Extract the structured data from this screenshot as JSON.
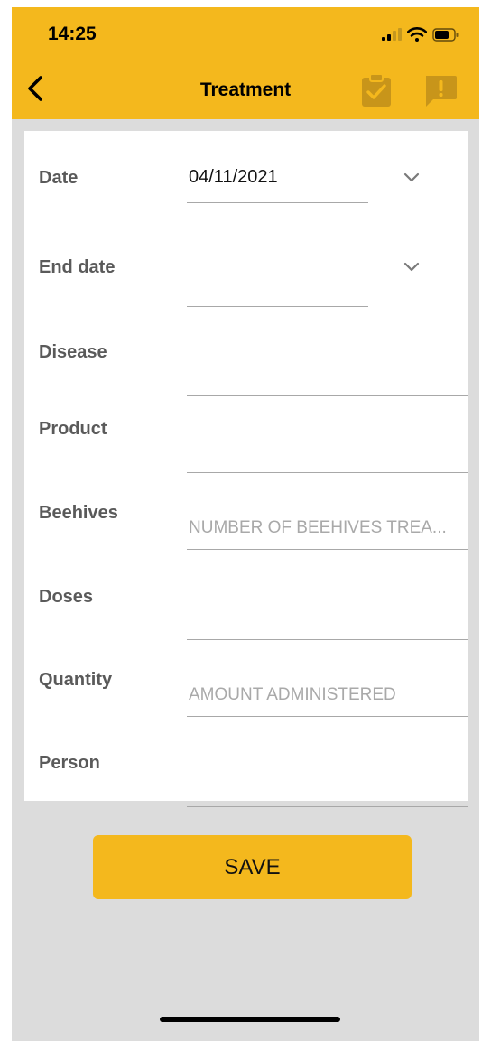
{
  "status_bar": {
    "time": "14:25",
    "icons": [
      "signal-icon",
      "wifi-icon",
      "battery-icon"
    ]
  },
  "nav": {
    "title": "Treatment",
    "back_icon": "chevron-left-icon",
    "actions": [
      "clipboard-check-icon",
      "alert-message-icon"
    ]
  },
  "form": {
    "fields": [
      {
        "label": "Date",
        "value": "04/11/2021",
        "type": "dropdown"
      },
      {
        "label": "End date",
        "value": "",
        "type": "dropdown"
      },
      {
        "label": "Disease",
        "value": "",
        "placeholder": ""
      },
      {
        "label": "Product",
        "value": "",
        "placeholder": ""
      },
      {
        "label": "Beehives",
        "value": "",
        "placeholder": "NUMBER OF BEEHIVES TREA..."
      },
      {
        "label": "Doses",
        "value": "",
        "placeholder": ""
      },
      {
        "label": "Quantity",
        "value": "",
        "placeholder": "AMOUNT ADMINISTERED"
      },
      {
        "label": "Person",
        "value": "",
        "placeholder": ""
      }
    ]
  },
  "save_label": "SAVE",
  "colors": {
    "accent": "#f4b81d",
    "accent_icon": "#c8951a",
    "background": "#dcdcdc",
    "label": "#5a5a5a",
    "placeholder": "#a9a9a9"
  }
}
